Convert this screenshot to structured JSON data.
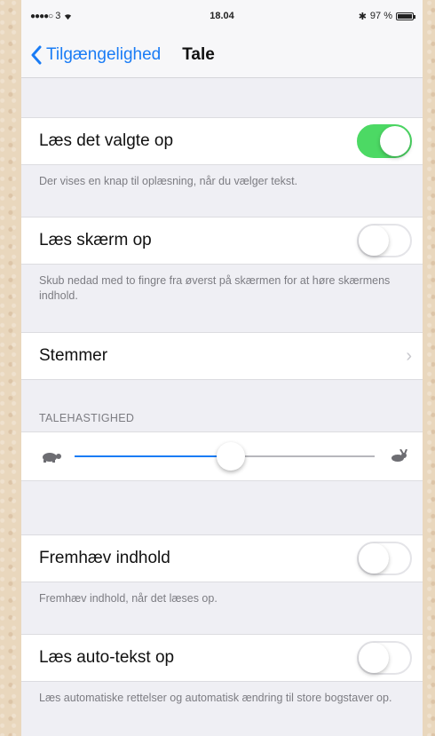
{
  "status": {
    "carrier": "3",
    "time": "18.04",
    "battery": "97 %",
    "battery_level": 0.97
  },
  "nav": {
    "back_label": "Tilgængelighed",
    "title": "Tale"
  },
  "rows": {
    "speak_selection": {
      "label": "Læs det valgte op",
      "on": true,
      "footer": "Der vises en knap til oplæsning, når du vælger tekst."
    },
    "speak_screen": {
      "label": "Læs skærm op",
      "on": false,
      "footer": "Skub nedad med to fingre fra øverst på skærmen for at høre skærmens indhold."
    },
    "voices": {
      "label": "Stemmer"
    },
    "rate": {
      "header": "TALEHASTIGHED",
      "value": 0.52
    },
    "highlight": {
      "label": "Fremhæv indhold",
      "on": false,
      "footer": "Fremhæv indhold, når det læses op."
    },
    "autotext": {
      "label": "Læs auto-tekst op",
      "on": false,
      "footer": "Læs automatiske rettelser og automatisk ændring til store bogstaver op."
    }
  },
  "colors": {
    "accent": "#1a7cf5",
    "toggle_on": "#4cd964"
  }
}
